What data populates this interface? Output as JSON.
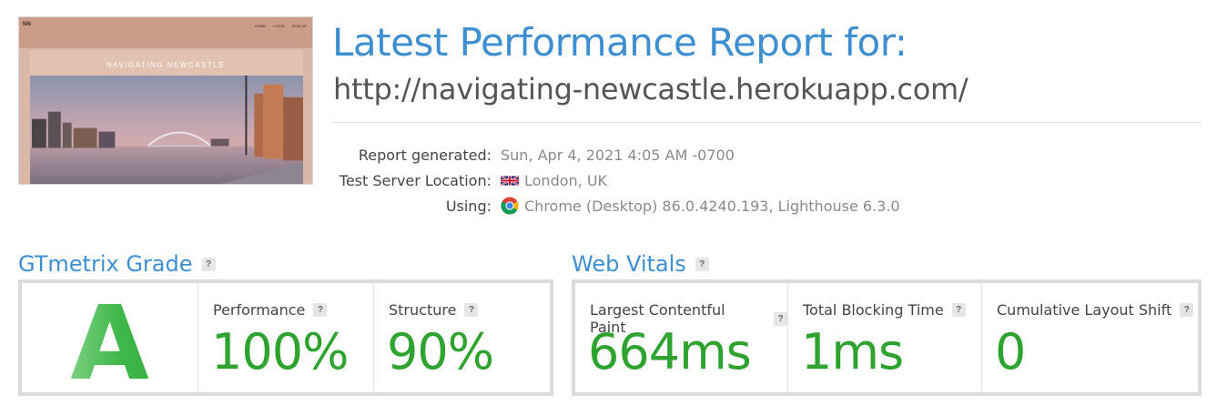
{
  "thumbnail": {
    "logo": "NN",
    "nav_links": [
      "HOME",
      "LOGIN",
      "SIGN UP"
    ],
    "hero_title": "NAVIGATING NEWCASTLE"
  },
  "header": {
    "title": "Latest Performance Report for:",
    "url": "http://navigating-newcastle.herokuapp.com/"
  },
  "meta": {
    "report_generated_label": "Report generated:",
    "report_generated_value": "Sun, Apr 4, 2021 4:05 AM -0700",
    "server_label": "Test Server Location:",
    "server_value": "London, UK",
    "using_label": "Using:",
    "using_value": "Chrome (Desktop) 86.0.4240.193, Lighthouse 6.3.0"
  },
  "grade": {
    "section_title": "GTmetrix Grade",
    "help": "?",
    "letter": "A",
    "performance_label": "Performance",
    "performance_value": "100%",
    "structure_label": "Structure",
    "structure_value": "90%"
  },
  "vitals": {
    "section_title": "Web Vitals",
    "help": "?",
    "lcp_label": "Largest Contentful Paint",
    "lcp_value": "664ms",
    "tbt_label": "Total Blocking Time",
    "tbt_value": "1ms",
    "cls_label": "Cumulative Layout Shift",
    "cls_value": "0"
  },
  "colors": {
    "accent_blue": "#3d8fd1",
    "score_green": "#2fa32f"
  }
}
